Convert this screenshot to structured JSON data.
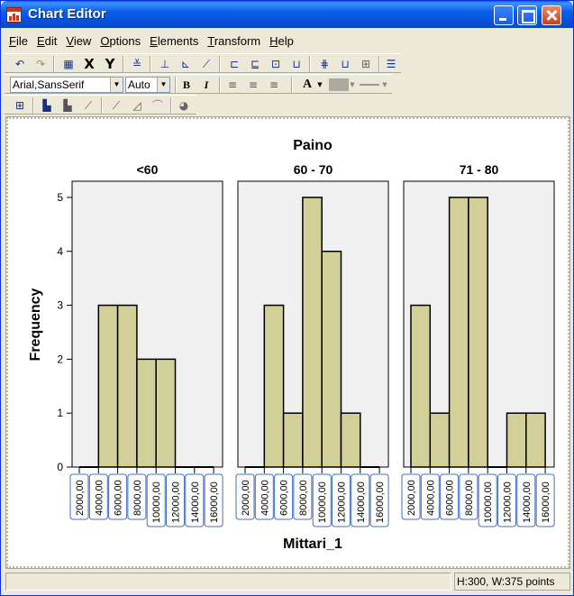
{
  "window": {
    "title": "Chart Editor"
  },
  "menu": [
    {
      "label": "File",
      "u": "F",
      "rest": "ile"
    },
    {
      "label": "Edit",
      "u": "E",
      "rest": "dit"
    },
    {
      "label": "View",
      "u": "V",
      "rest": "iew"
    },
    {
      "label": "Options",
      "u": "O",
      "rest": "ptions"
    },
    {
      "label": "Elements",
      "u": "E",
      "rest": "lements"
    },
    {
      "label": "Transform",
      "u": "T",
      "rest": "ransform"
    },
    {
      "label": "Help",
      "u": "H",
      "rest": "elp"
    }
  ],
  "toolbar": {
    "x_label": "X",
    "y_label": "Y",
    "font_value": "Arial,SansSerif",
    "size_value": "Auto",
    "bold_label": "B",
    "italic_label": "I",
    "text_color_label": "A"
  },
  "status": {
    "right": "H:300, W:375 points"
  },
  "chart_data": {
    "type": "bar",
    "title": "Paino",
    "xlabel": "Mittari_1",
    "ylabel": "Frequency",
    "ylim": [
      0,
      5.3
    ],
    "yticks": [
      0,
      1,
      2,
      3,
      4,
      5
    ],
    "categories": [
      "2000,00",
      "4000,00",
      "6000,00",
      "8000,00",
      "10000,00",
      "12000,00",
      "14000,00",
      "16000,00"
    ],
    "bar_color": "#d3cf98",
    "panel_color": "#f0f0f0",
    "label_border_color": "#4170c0",
    "panels": [
      {
        "name": "<60",
        "values": [
          0,
          3,
          3,
          2,
          2,
          0,
          0
        ]
      },
      {
        "name": "60 - 70",
        "values": [
          0,
          3,
          1,
          5,
          4,
          1,
          0
        ]
      },
      {
        "name": "71 - 80",
        "values": [
          3,
          1,
          5,
          5,
          0,
          1,
          1
        ]
      }
    ]
  }
}
